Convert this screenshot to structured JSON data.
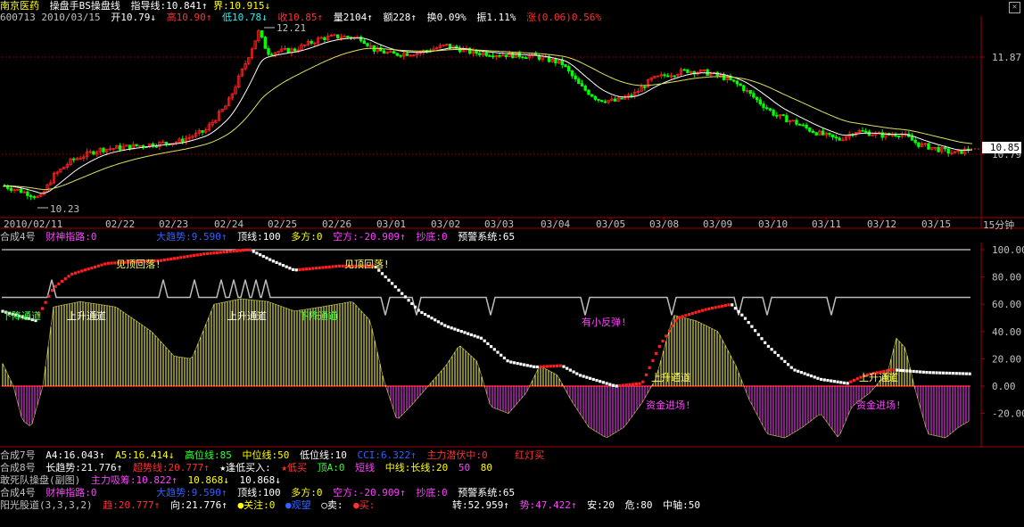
{
  "header": {
    "stock_name": "南京医药",
    "indicator_name": "操盘手BS操盘线",
    "guide_line": "指导线:10.841↑",
    "bound_line": "界:10.915↓",
    "code_date": "600713 2010/03/15",
    "open": "开10.79↓",
    "high": "高10.90↑",
    "low": "低10.78↓",
    "close": "收10.85↑",
    "volume": "量2104↑",
    "amount": "额228↑",
    "turnover": "换0.09%",
    "amplitude": "振1.11%",
    "change": "涨(0.06)0.56%"
  },
  "main_chart": {
    "price_badge": "10.85",
    "ticks": [
      "11.87",
      "10.79"
    ],
    "high_label": "12.21",
    "low_label": "10.23",
    "dates": [
      "2010/02/11",
      "02/22",
      "02/23",
      "02/24",
      "02/25",
      "02/26",
      "03/01",
      "03/02",
      "03/03",
      "03/04",
      "03/05",
      "03/08",
      "03/09",
      "03/10",
      "03/11",
      "03/12",
      "03/15"
    ],
    "period": "15分钟"
  },
  "sub_chart": {
    "legend": {
      "name": "合成4号",
      "caishen": "财神指路:0",
      "trend": "大趋势:9.590↑",
      "top": "顶线:100",
      "duo": "多方:0",
      "kong": "空方:-20.909↑",
      "chaodi": "抄底:0",
      "alarm": "预警系统:65"
    },
    "ticks": [
      "100.00",
      "80.00",
      "60.00",
      "40.00",
      "20.00",
      "0.00",
      "-20.00"
    ],
    "annotations": [
      "见顶回落!",
      "见顶回落!",
      "下降通道",
      "上升通道",
      "上升通道",
      "下降通道",
      "有小反弹!",
      "上升通道",
      "上升通道",
      "资金进场!",
      "资金进场!"
    ]
  },
  "bottom_bars": {
    "row1": [
      "合成7号",
      "A4:16.043↑",
      "A5:16.414↓",
      "高位线:85",
      "中位线:50",
      "低位线:10",
      "CCI:6.322↑",
      "主力潜伏中:0",
      "红灯买"
    ],
    "row2": [
      "合成8号",
      "长趋势:21.776↑",
      "超势线:20.777↑",
      "★逢低买入:",
      "★低买",
      "顶A:0",
      "短线",
      "中线:长线:20",
      "50",
      "80"
    ],
    "row3": [
      "敢死队操盘(副图)",
      "主力吸筹:10.822↑",
      "10.868↓",
      "10.868↓"
    ],
    "row4": [
      "合成4号",
      "财神指路:0",
      "大趋势:9.590↑",
      "顶线:100",
      "多方:0",
      "空方:-20.909↑",
      "抄底:0",
      "预警系统:65"
    ],
    "row5": [
      "阳光股道(3,3,3,2)",
      "趋:20.777↑",
      "向:21.776↑",
      "●关注:0",
      "●观望",
      "○卖:",
      "●买:",
      "转:52.959↑",
      "势:47.422↑",
      "安:20",
      "危:80",
      "中轴:50"
    ]
  },
  "colors": {
    "up": "#ff2020",
    "down": "#00ff00",
    "ma1": "#ffffff",
    "ma2": "#e0e060",
    "grid": "#a00000",
    "text": "#c0c0c0"
  }
}
